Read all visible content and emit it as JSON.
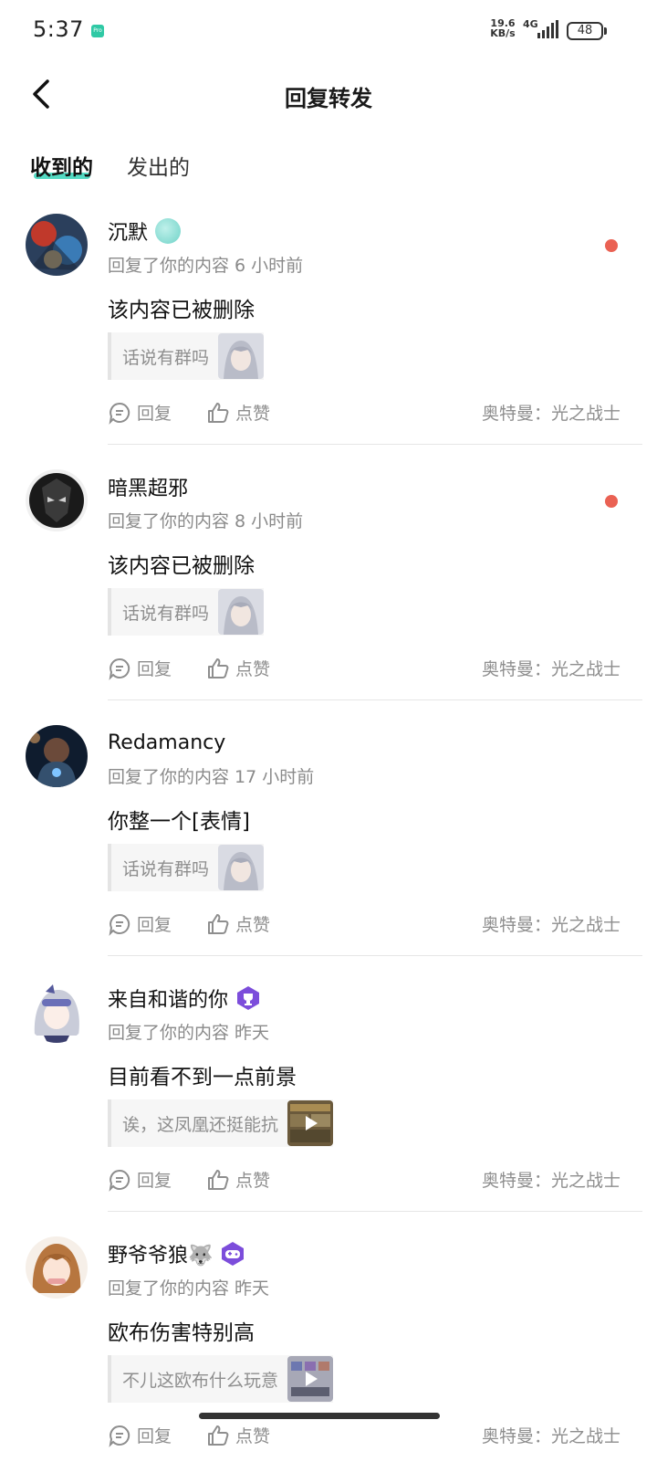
{
  "status_bar": {
    "time": "5:37",
    "app_icon": "app-notification-icon",
    "net_speed_value": "19.6",
    "net_speed_unit": "KB/s",
    "network_type": "4G",
    "battery": "48"
  },
  "nav": {
    "back_icon": "chevron-left-icon",
    "title": "回复转发"
  },
  "tabs": [
    {
      "label": "收到的",
      "active": true
    },
    {
      "label": "发出的",
      "active": false
    }
  ],
  "colors": {
    "accent": "#35d3b8",
    "unread": "#ea6153",
    "muted_text": "#8e8e8e"
  },
  "items": [
    {
      "username": "沉默",
      "badge_icon": "teal-badge-icon",
      "meta": "回复了你的内容 6 小时前",
      "unread": true,
      "content": "该内容已被删除",
      "quote_text": "话说有群吗",
      "thumb_type": "image",
      "reply_label": "回复",
      "like_label": "点赞",
      "source": "奥特曼：光之战士"
    },
    {
      "username": "暗黑超邪",
      "badge_icon": "",
      "meta": "回复了你的内容 8 小时前",
      "unread": true,
      "content": "该内容已被删除",
      "quote_text": "话说有群吗",
      "thumb_type": "image",
      "reply_label": "回复",
      "like_label": "点赞",
      "source": "奥特曼：光之战士"
    },
    {
      "username": "Redamancy",
      "badge_icon": "",
      "meta": "回复了你的内容 17 小时前",
      "unread": false,
      "content": "你整一个[表情]",
      "quote_text": "话说有群吗",
      "thumb_type": "image",
      "reply_label": "回复",
      "like_label": "点赞",
      "source": "奥特曼：光之战士"
    },
    {
      "username": "来自和谐的你",
      "badge_icon": "purple-trophy-badge-icon",
      "meta": "回复了你的内容 昨天",
      "unread": false,
      "content": "目前看不到一点前景",
      "quote_text": "诶，这凤凰还挺能抗",
      "thumb_type": "video",
      "reply_label": "回复",
      "like_label": "点赞",
      "source": "奥特曼：光之战士"
    },
    {
      "username": "野爷爷狼🐺",
      "badge_icon": "purple-gamepad-badge-icon",
      "meta": "回复了你的内容 昨天",
      "unread": false,
      "content": "欧布伤害特别高",
      "quote_text": "不儿这欧布什么玩意",
      "thumb_type": "video",
      "reply_label": "回复",
      "like_label": "点赞",
      "source": "奥特曼：光之战士"
    }
  ]
}
